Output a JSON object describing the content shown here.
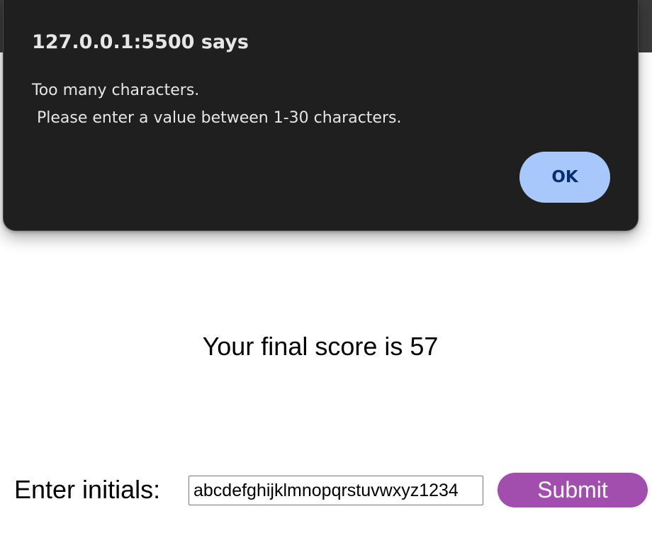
{
  "alert": {
    "title": "127.0.0.1:5500 says",
    "message": "Too many characters.\n Please enter a value between 1-30 characters.",
    "ok_label": "OK"
  },
  "main": {
    "score_text": "Your final score is 57",
    "initials_label": "Enter initials:",
    "initials_value": "abcdefghijklmnopqrstuvwxyz1234",
    "submit_label": "Submit"
  },
  "colors": {
    "dialog_background": "#1f1f1f",
    "ok_button": "#a8c7fa",
    "submit_button": "#a24eae"
  }
}
